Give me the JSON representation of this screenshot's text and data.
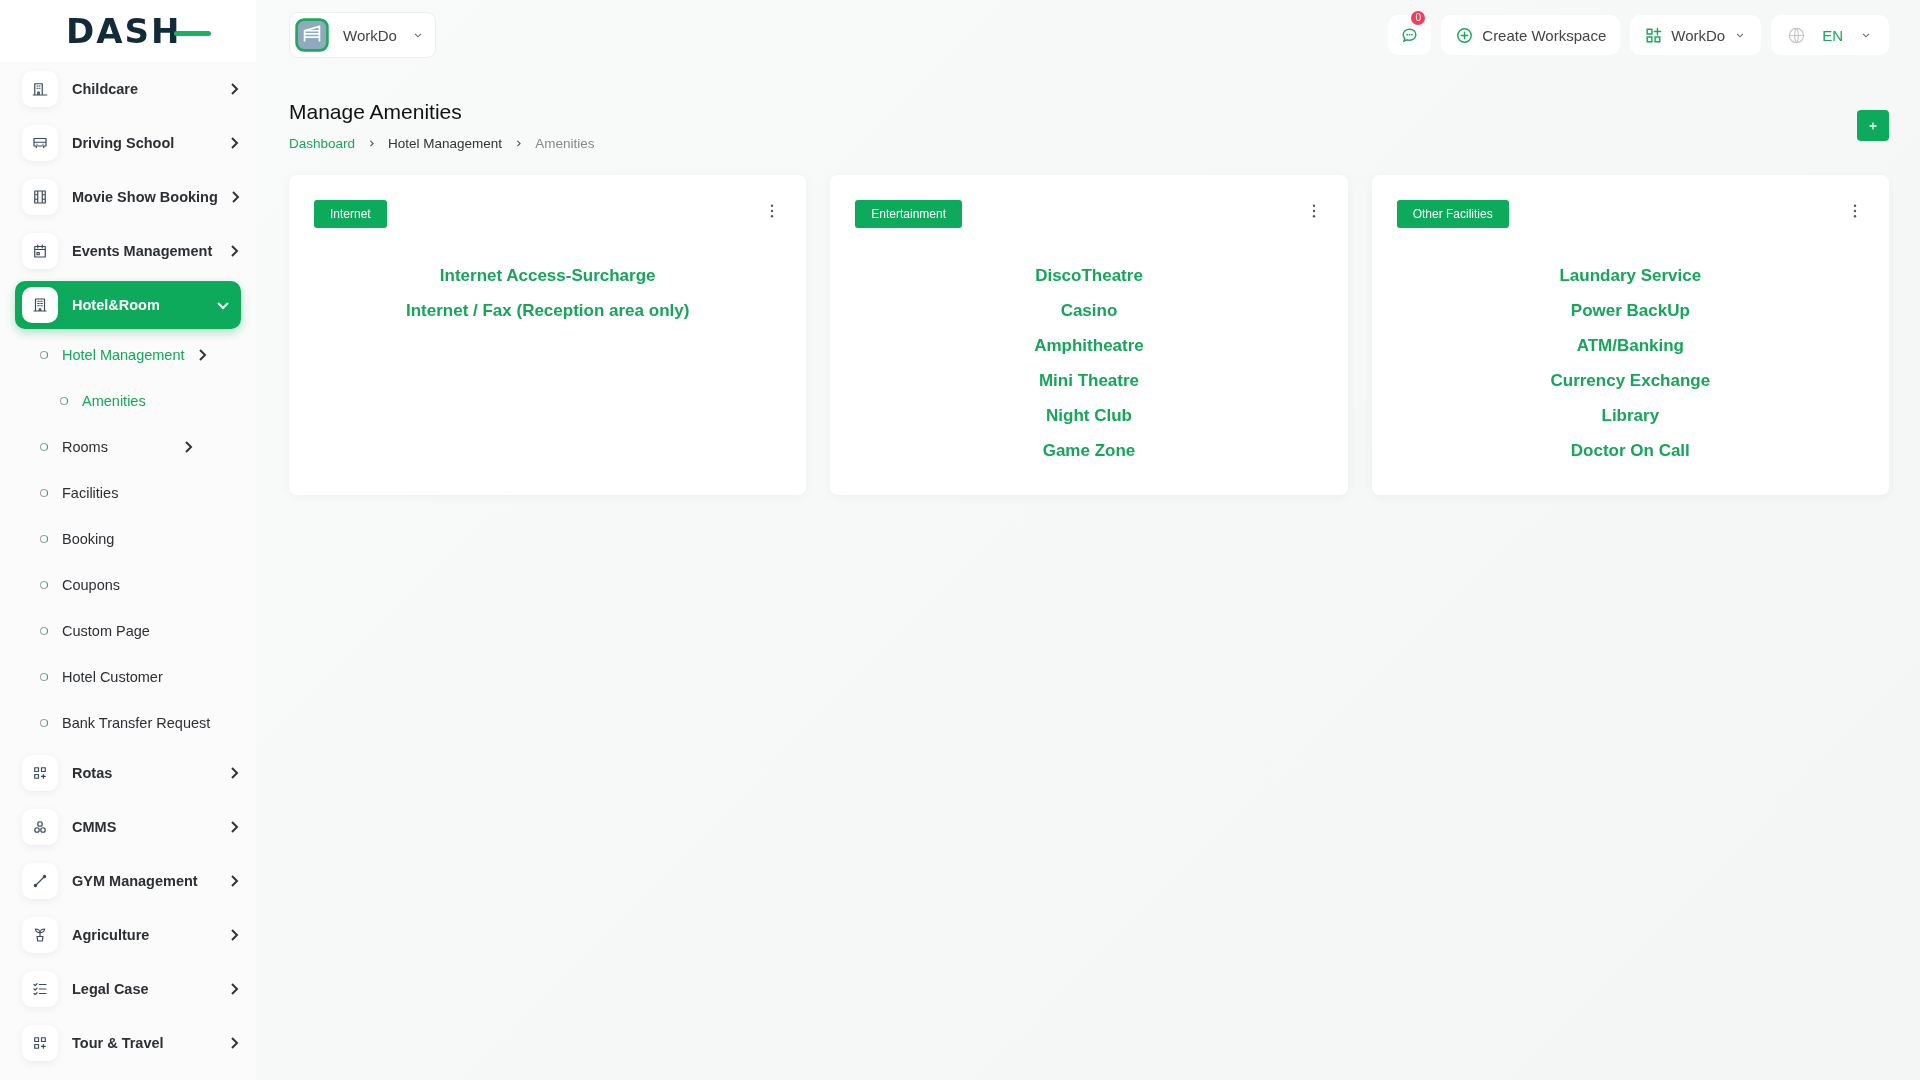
{
  "logo": {
    "text": "DASH"
  },
  "header": {
    "workspace_selector": {
      "label": "WorkDo"
    },
    "messages": {
      "badge": "0"
    },
    "create_button": {
      "label": "Create Workspace"
    },
    "workspace_menu": {
      "label": "WorkDo"
    },
    "language": {
      "label": "EN"
    }
  },
  "sidebar": {
    "items": [
      {
        "label": "Childcare",
        "selected": false,
        "expanded": false
      },
      {
        "label": "Driving School",
        "selected": false,
        "expanded": false
      },
      {
        "label": "Movie Show Booking",
        "selected": false,
        "expanded": false
      },
      {
        "label": "Events Management",
        "selected": false,
        "expanded": false
      },
      {
        "label": "Hotel&Room",
        "selected": true,
        "expanded": true,
        "children": [
          {
            "label": "Hotel Management",
            "selected": true,
            "expandable": true,
            "children": [
              {
                "label": "Amenities",
                "selected": true
              }
            ]
          },
          {
            "label": "Rooms",
            "selected": false,
            "expandable": true
          },
          {
            "label": "Facilities",
            "selected": false,
            "expandable": false
          },
          {
            "label": "Booking",
            "selected": false,
            "expandable": false
          },
          {
            "label": "Coupons",
            "selected": false,
            "expandable": false
          },
          {
            "label": "Custom Page",
            "selected": false,
            "expandable": false
          },
          {
            "label": "Hotel Customer",
            "selected": false,
            "expandable": false
          },
          {
            "label": "Bank Transfer Request",
            "selected": false,
            "expandable": false
          }
        ]
      },
      {
        "label": "Rotas",
        "selected": false,
        "expanded": false
      },
      {
        "label": "CMMS",
        "selected": false,
        "expanded": false
      },
      {
        "label": "GYM Management",
        "selected": false,
        "expanded": false
      },
      {
        "label": "Agriculture",
        "selected": false,
        "expanded": false
      },
      {
        "label": "Legal Case",
        "selected": false,
        "expanded": false
      },
      {
        "label": "Tour & Travel",
        "selected": false,
        "expanded": false
      }
    ]
  },
  "page": {
    "title": "Manage Amenities",
    "breadcrumb": [
      "Dashboard",
      "Hotel Management",
      "Amenities"
    ]
  },
  "cards": [
    {
      "category": "Internet",
      "amenities": [
        "Internet Access-Surcharge",
        "Internet / Fax (Reception area only)"
      ]
    },
    {
      "category": "Entertainment",
      "amenities": [
        "DiscoTheatre",
        "Casino",
        "Amphitheatre",
        "Mini Theatre",
        "Night Club",
        "Game Zone"
      ]
    },
    {
      "category": "Other Facilities",
      "amenities": [
        "Laundary Service",
        "Power BackUp",
        "ATM/Banking",
        "Currency Exchange",
        "Library",
        "Doctor On Call"
      ]
    }
  ]
}
